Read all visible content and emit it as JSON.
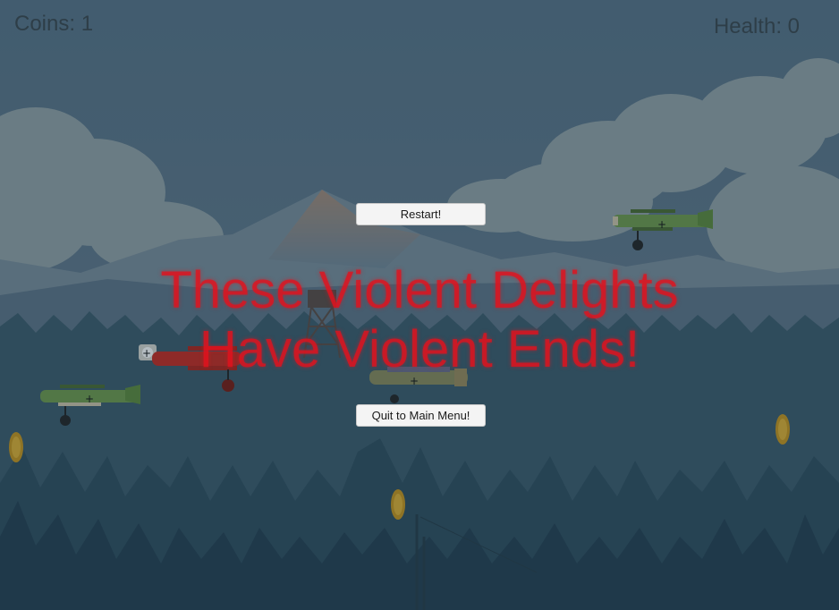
{
  "hud": {
    "coins_text": "Coins: 1",
    "health_text": "Health: 0"
  },
  "menu": {
    "restart_label": "Restart!",
    "quit_label": "Quit to Main Menu!"
  },
  "game_over": {
    "line1": "These Violent Delights",
    "line2": "Have Violent Ends!"
  },
  "entities": {
    "planes": [
      {
        "name": "green-biplane",
        "color": "#6f9a4a"
      },
      {
        "name": "red-triplane",
        "color": "#c8281e"
      },
      {
        "name": "camo-monoplane",
        "color": "#8a8a5a"
      }
    ],
    "coin_color": "#d4a017"
  },
  "colors": {
    "sky_top": "#5a7488",
    "sky_bottom": "#3d5d6f",
    "mountain": "#8898a6",
    "forest": "#2d4a5c",
    "alert_text": "#e1121e"
  }
}
